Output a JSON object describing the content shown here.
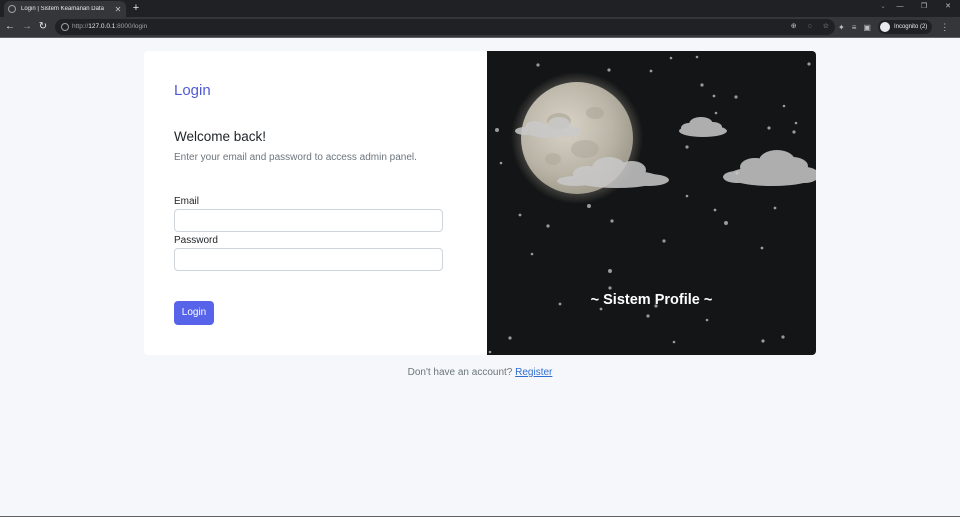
{
  "browser": {
    "tab_title": "Login | Sistem Keamanan Data",
    "tab_close": "✕",
    "new_tab": "+",
    "url_prefix": "http://",
    "url_host": "127.0.0.1",
    "url_rest": ":8000/login",
    "profile_label": "Incognito (2)",
    "icons": [
      "back-icon",
      "forward-icon",
      "reload-icon",
      "info-icon",
      "zoom-icon",
      "eye-off-icon",
      "star-icon",
      "extensions-icon",
      "reading-list-icon",
      "side-panel-icon",
      "menu-icon"
    ]
  },
  "login": {
    "brand": "Login",
    "heading": "Welcome back!",
    "subtitle": "Enter your email and password to access admin panel.",
    "email_label": "Email",
    "email_value": "",
    "password_label": "Password",
    "password_value": "",
    "submit_label": "Login"
  },
  "hero": {
    "caption": "~ Sistem Profile ~"
  },
  "footer": {
    "text": "Don't have an account?",
    "link": "Register"
  },
  "colors": {
    "accent": "#5763e8",
    "brand": "#4f5bd5",
    "link": "#2f6fd1",
    "page_bg": "#f5f7fa",
    "hero_bg": "#141516"
  }
}
